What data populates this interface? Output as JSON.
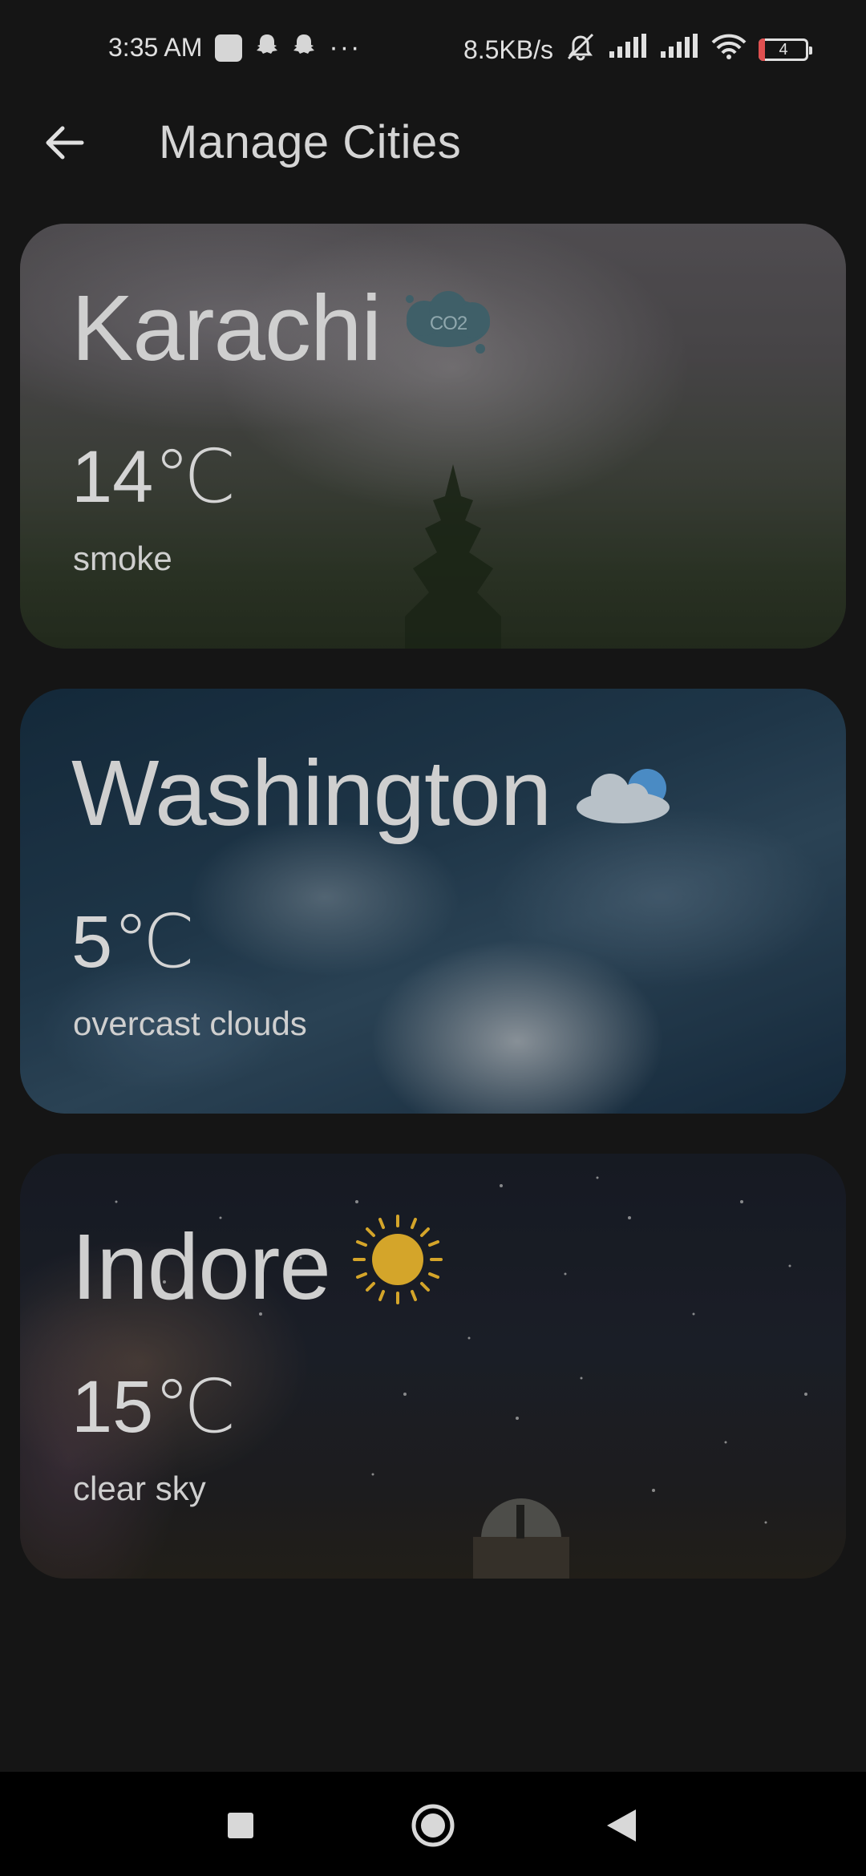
{
  "status_bar": {
    "time": "3:35 AM",
    "net_speed": "8.5KB/s",
    "battery": "4",
    "more": "···"
  },
  "app_bar": {
    "title": "Manage Cities"
  },
  "cities": [
    {
      "name": "Karachi",
      "temp": "14℃",
      "description": "smoke",
      "icon": "co2-smoke-icon"
    },
    {
      "name": "Washington",
      "temp": "5℃",
      "description": "overcast clouds",
      "icon": "cloud-icon"
    },
    {
      "name": "Indore",
      "temp": "15℃",
      "description": "clear sky",
      "icon": "sun-icon"
    }
  ],
  "colors": {
    "background": "#151515",
    "sun": "#d4a52a",
    "cloud_blue": "#4a8bc4"
  },
  "icons": {
    "co2_text": "CO2"
  }
}
